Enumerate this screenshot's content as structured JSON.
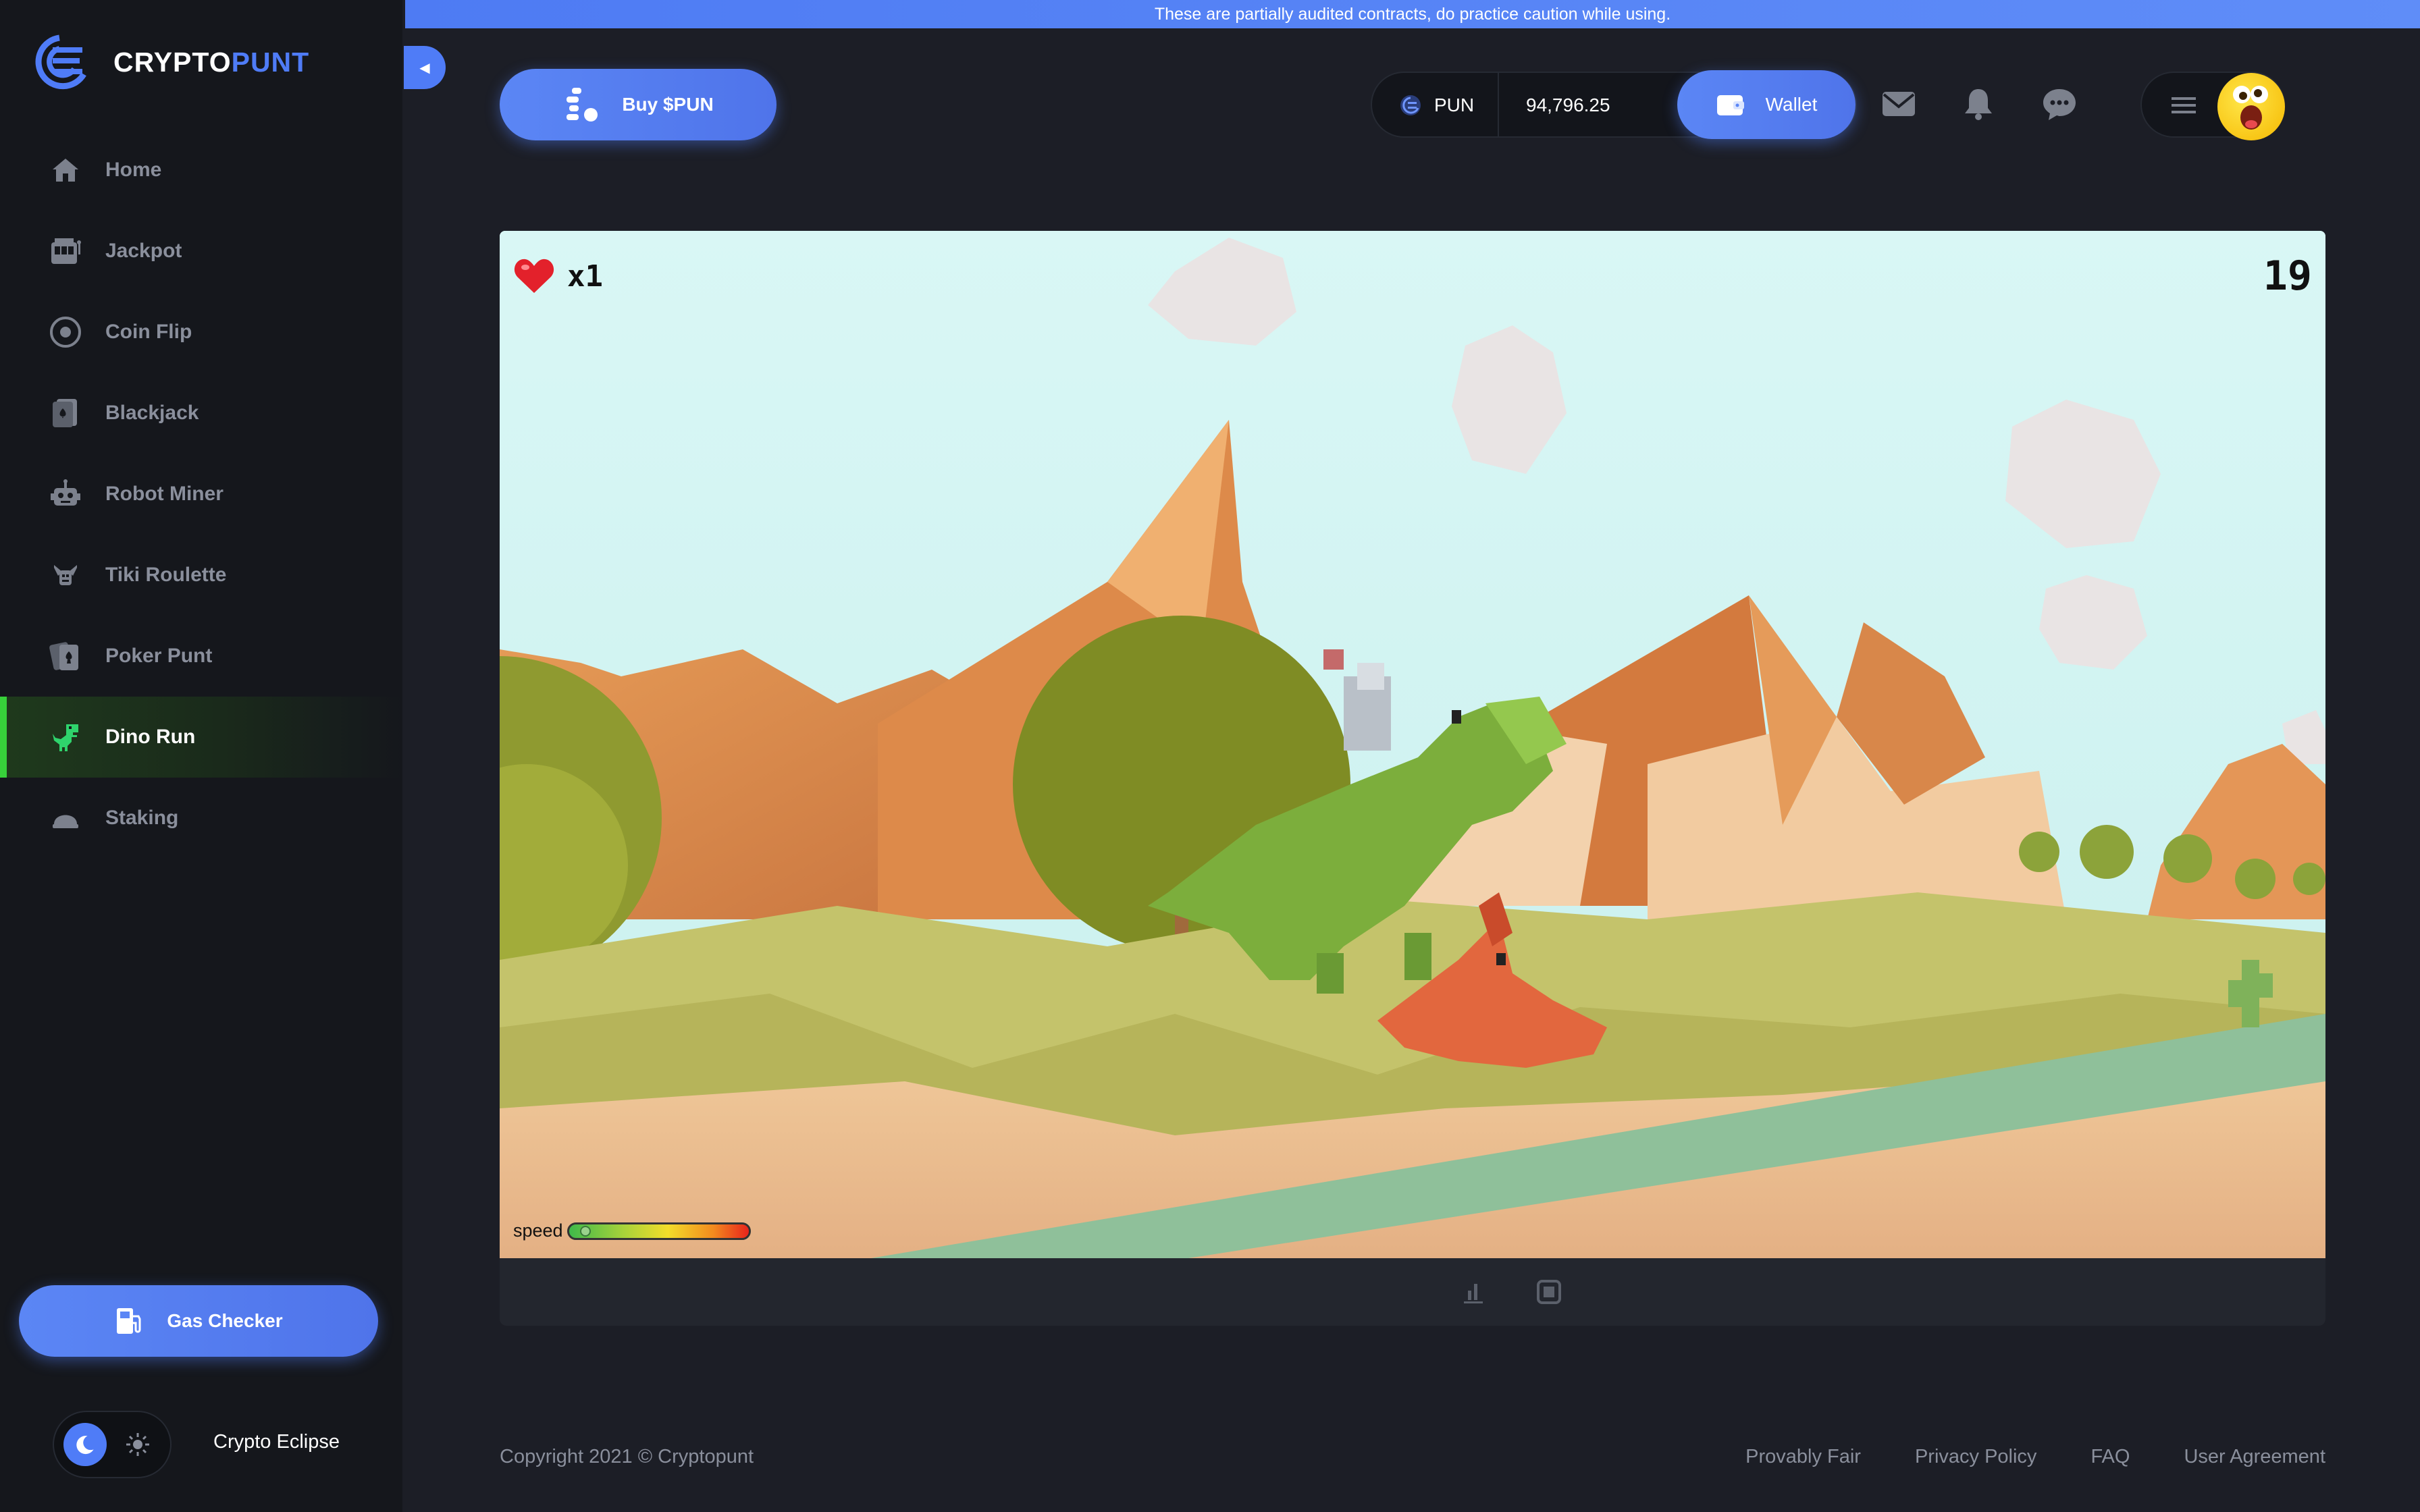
{
  "brand": {
    "name_part1": "CRYPTO",
    "name_part2": "PUNT"
  },
  "banner": {
    "text": "These are partially audited contracts, do practice caution while using."
  },
  "sidebar": {
    "items": [
      {
        "label": "Home",
        "icon": "home-icon"
      },
      {
        "label": "Jackpot",
        "icon": "slot-machine-icon"
      },
      {
        "label": "Coin Flip",
        "icon": "coin-icon"
      },
      {
        "label": "Blackjack",
        "icon": "cards-icon"
      },
      {
        "label": "Robot Miner",
        "icon": "robot-icon"
      },
      {
        "label": "Tiki Roulette",
        "icon": "tiki-icon"
      },
      {
        "label": "Poker Punt",
        "icon": "poker-icon"
      },
      {
        "label": "Dino Run",
        "icon": "dino-icon",
        "active": true
      },
      {
        "label": "Staking",
        "icon": "staking-icon"
      }
    ],
    "gas_checker_label": "Gas Checker",
    "theme_label": "Crypto Eclipse"
  },
  "header": {
    "buy_label": "Buy $PUN",
    "token_symbol": "PUN",
    "balance": "94,796.25",
    "wallet_label": "Wallet"
  },
  "game": {
    "lives": "x1",
    "score": "19",
    "speed_label": "speed",
    "speed_level": 0.05
  },
  "footer": {
    "copyright": "Copyright 2021 © Cryptopunt",
    "links": [
      "Provably Fair",
      "Privacy Policy",
      "FAQ",
      "User Agreement"
    ]
  },
  "colors": {
    "accent": "#4f7cf7",
    "active_nav": "#37d13a",
    "background": "#1c1e26",
    "sidebar": "#15171c"
  }
}
